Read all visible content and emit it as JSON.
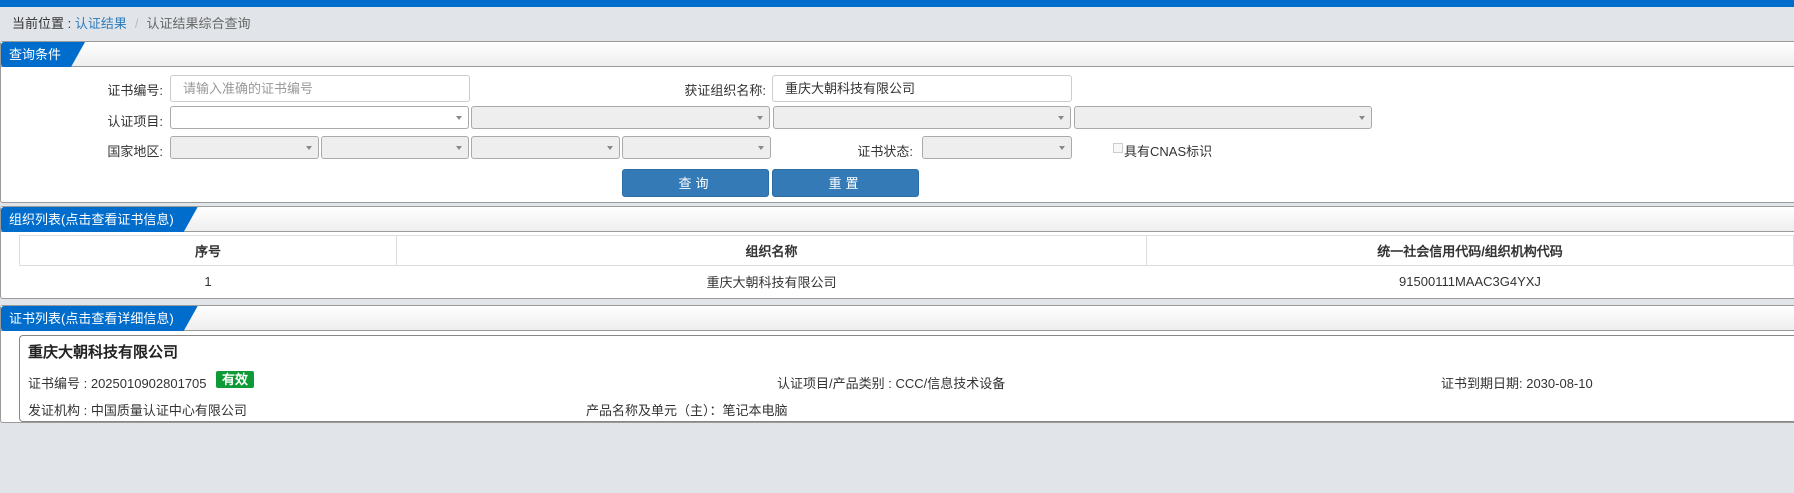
{
  "breadcrumb": {
    "prefix": "当前位置 : ",
    "link": "认证结果",
    "separator": "/",
    "current": "认证结果综合查询"
  },
  "query_panel": {
    "title": "查询条件",
    "cert_no_label": "证书编号:",
    "cert_no_placeholder": "请输入准确的证书编号",
    "cert_no_value": "",
    "org_name_label": "获证组织名称:",
    "org_name_value": "重庆大朝科技有限公司",
    "cert_item_label": "认证项目:",
    "region_label": "国家地区:",
    "status_label": "证书状态:",
    "cnas_label": "具有CNAS标识",
    "cnas_checked": false,
    "search_button": "查询",
    "reset_button": "重置"
  },
  "org_panel": {
    "title": "组织列表(点击查看证书信息)",
    "columns": [
      "序号",
      "组织名称",
      "统一社会信用代码/组织机构代码"
    ],
    "rows": [
      [
        "1",
        "重庆大朝科技有限公司",
        "91500111MAAC3G4YXJ"
      ]
    ]
  },
  "cert_panel": {
    "title": "证书列表(点击查看详细信息)",
    "card": {
      "org_name": "重庆大朝科技有限公司",
      "cert_no": "证书编号 : 2025010902801705",
      "status": "有效",
      "status_color": "#0e9a36",
      "item": "认证项目/产品类别 : CCC/信息技术设备",
      "expiry": "证书到期日期: 2030-08-10",
      "issuer": "发证机构 : 中国质量认证中心有限公司",
      "product": "产品名称及单元（主）：笔记本电脑"
    }
  }
}
